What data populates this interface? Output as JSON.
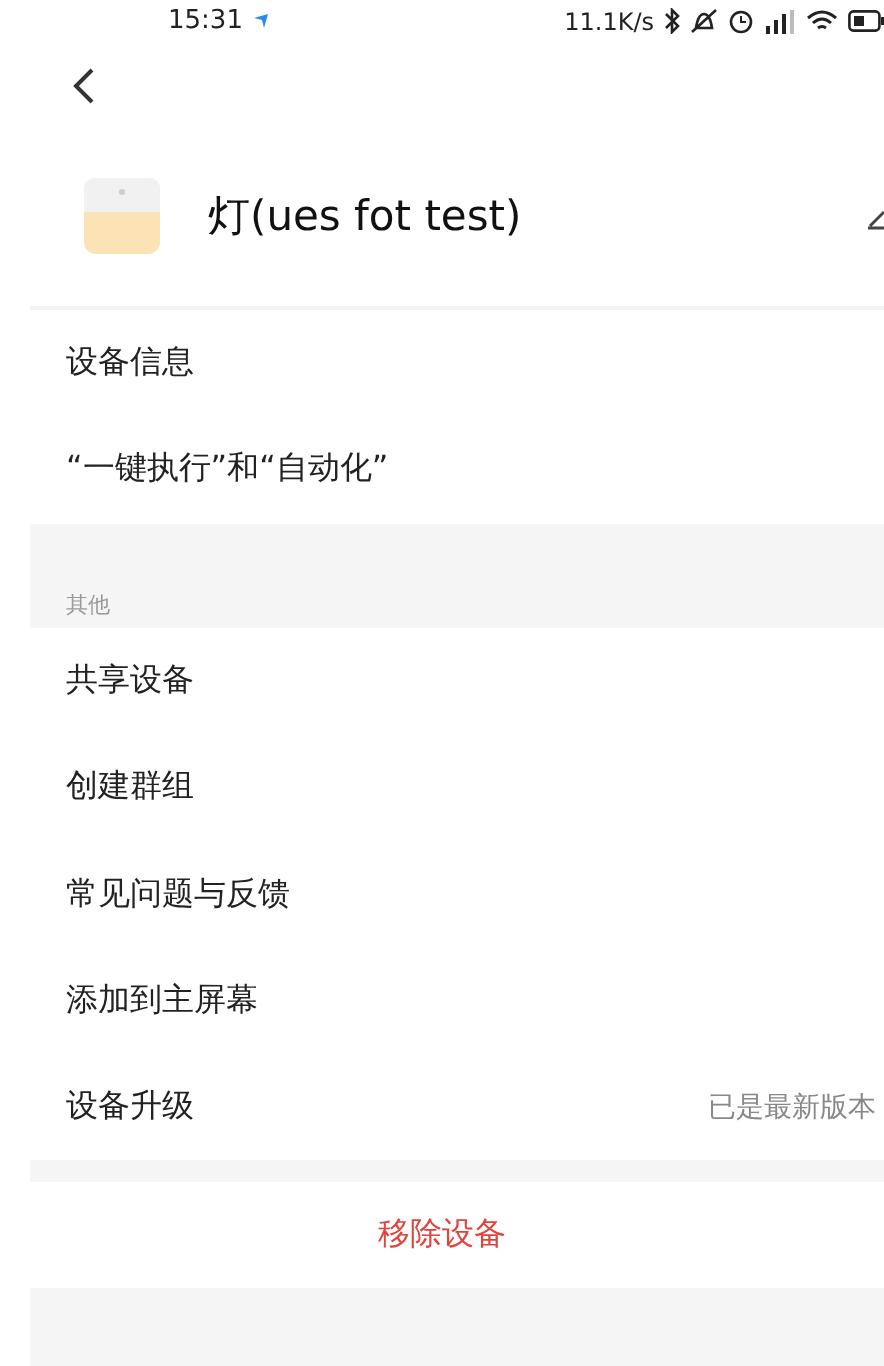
{
  "status_bar": {
    "time": "15:31",
    "speed": "11.1K/s"
  },
  "device": {
    "name": "灯(ues fot test)"
  },
  "sections": [
    {
      "items": [
        {
          "label": "设备信息"
        },
        {
          "label": "“一键执行”和“自动化”"
        }
      ]
    },
    {
      "header": "其他",
      "items": [
        {
          "label": "共享设备"
        },
        {
          "label": "创建群组"
        },
        {
          "label": "常见问题与反馈"
        },
        {
          "label": "添加到主屏幕"
        },
        {
          "label": "设备升级",
          "value": "已是最新版本"
        }
      ]
    }
  ],
  "remove_button": "移除设备"
}
